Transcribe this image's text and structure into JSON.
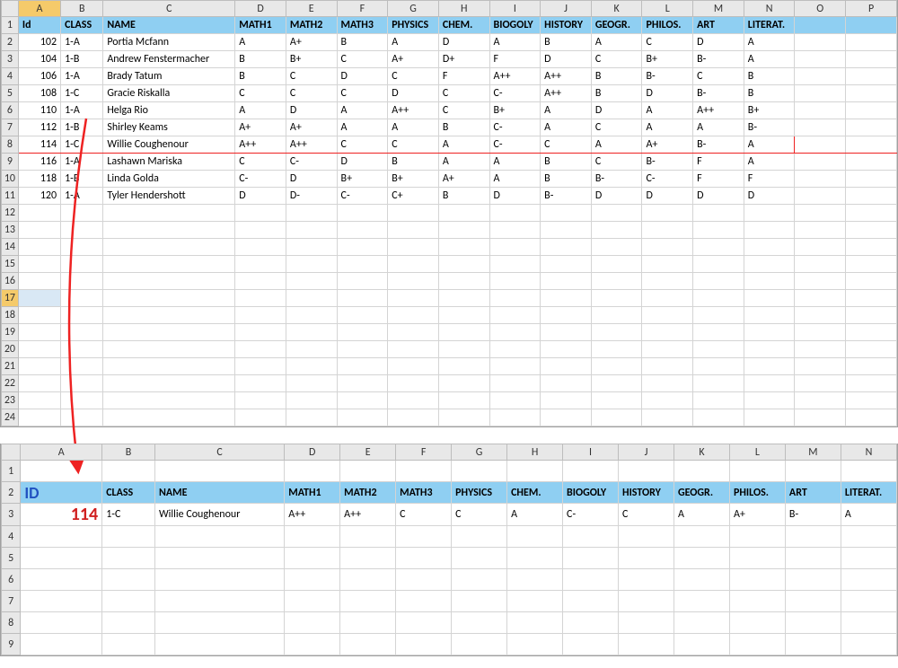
{
  "sheet1": {
    "columns": [
      "A",
      "B",
      "C",
      "D",
      "E",
      "F",
      "G",
      "H",
      "I",
      "J",
      "K",
      "L",
      "M",
      "N",
      "O",
      "P"
    ],
    "headers": [
      "Id",
      "CLASS",
      "NAME",
      "MATH1",
      "MATH2",
      "MATH3",
      "PHYSICS",
      "CHEM.",
      "BIOGOLY",
      "HISTORY",
      "GEOGR.",
      "PHILOS.",
      "ART",
      "LITERAT."
    ],
    "rows": [
      {
        "id": 102,
        "class": "1-A",
        "name": "Portia Mcfann",
        "g": [
          "A",
          "A+",
          "B",
          "A",
          "D",
          "A",
          "B",
          "A",
          "C",
          "D",
          "A"
        ]
      },
      {
        "id": 104,
        "class": "1-B",
        "name": "Andrew Fenstermacher",
        "g": [
          "B",
          "B+",
          "C",
          "A+",
          "D+",
          "F",
          "D",
          "C",
          "B+",
          "B-",
          "A"
        ]
      },
      {
        "id": 106,
        "class": "1-A",
        "name": "Brady Tatum",
        "g": [
          "B",
          "C",
          "D",
          "C",
          "F",
          "A++",
          "A++",
          "B",
          "B-",
          "C",
          "B"
        ]
      },
      {
        "id": 108,
        "class": "1-C",
        "name": "Gracie Riskalla",
        "g": [
          "C",
          "C",
          "C",
          "D",
          "C",
          "C-",
          "A++",
          "B",
          "D",
          "B-",
          "B"
        ]
      },
      {
        "id": 110,
        "class": "1-A",
        "name": "Helga Rio",
        "g": [
          "A",
          "D",
          "A",
          "A++",
          "C",
          "B+",
          "A",
          "D",
          "A",
          "A++",
          "B+"
        ]
      },
      {
        "id": 112,
        "class": "1-B",
        "name": "Shirley Keams",
        "g": [
          "A+",
          "A+",
          "A",
          "A",
          "B",
          "C-",
          "A",
          "C",
          "A",
          "A",
          "B-"
        ]
      },
      {
        "id": 114,
        "class": "1-C",
        "name": "Willie Coughenour",
        "g": [
          "A++",
          "A++",
          "C",
          "C",
          "A",
          "C-",
          "C",
          "A",
          "A+",
          "B-",
          "A"
        ]
      },
      {
        "id": 116,
        "class": "1-A",
        "name": "Lashawn Mariska",
        "g": [
          "C",
          "C-",
          "D",
          "B",
          "A",
          "A",
          "B",
          "C",
          "B-",
          "F",
          "A"
        ]
      },
      {
        "id": 118,
        "class": "1-B",
        "name": "Linda Golda",
        "g": [
          "C-",
          "D",
          "B+",
          "B+",
          "A+",
          "A",
          "B",
          "B-",
          "C-",
          "F",
          "F"
        ]
      },
      {
        "id": 120,
        "class": "1-A",
        "name": "Tyler Hendershott",
        "g": [
          "D",
          "D-",
          "C-",
          "C+",
          "B",
          "D",
          "B-",
          "D",
          "D",
          "D",
          "D"
        ]
      }
    ],
    "highlightId": 114,
    "selectedCell": "A17",
    "lastRow": 24
  },
  "sheet2": {
    "columns": [
      "A",
      "B",
      "C",
      "D",
      "E",
      "F",
      "G",
      "H",
      "I",
      "J",
      "K",
      "L",
      "M",
      "N"
    ],
    "idHeader": "ID",
    "headers": [
      "CLASS",
      "NAME",
      "MATH1",
      "MATH2",
      "MATH3",
      "PHYSICS",
      "CHEM.",
      "BIOGOLY",
      "HISTORY",
      "GEOGR.",
      "PHILOS.",
      "ART",
      "LITERAT."
    ],
    "idValue": 114,
    "row": {
      "class": "1-C",
      "name": "Willie Coughenour",
      "g": [
        "A++",
        "A++",
        "C",
        "C",
        "A",
        "C-",
        "C",
        "A",
        "A+",
        "B-",
        "A"
      ]
    },
    "lastRow": 9
  }
}
